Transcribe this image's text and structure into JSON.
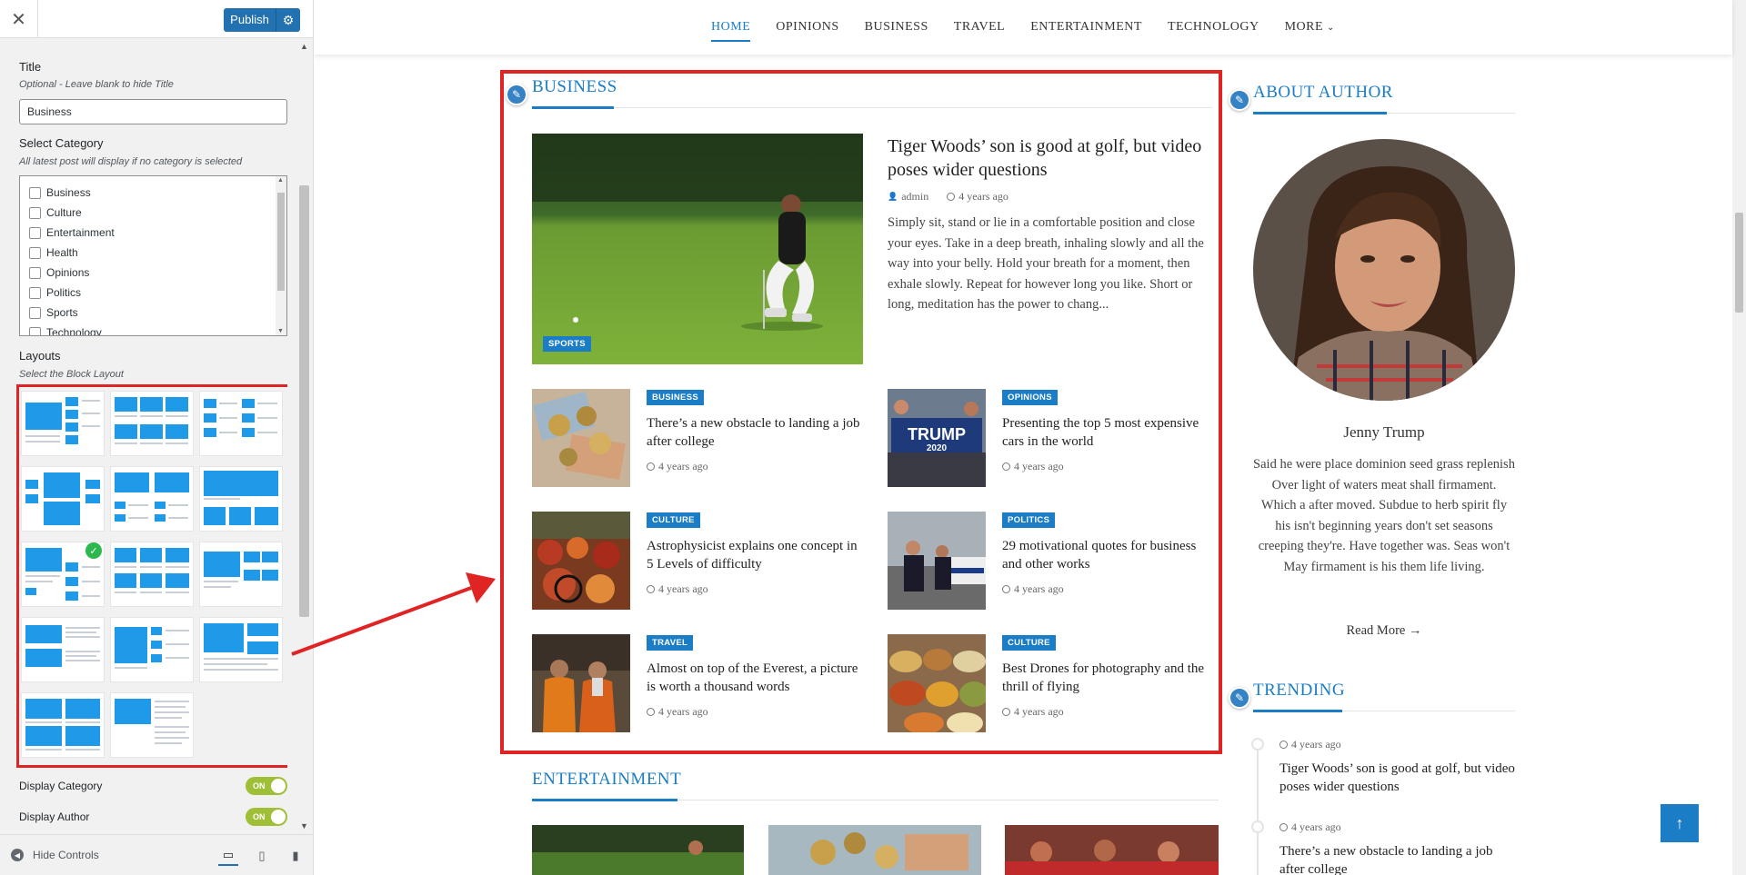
{
  "customizer": {
    "close_icon": "close-icon",
    "publish_label": "Publish",
    "title_label": "Title",
    "title_desc": "Optional - Leave blank to hide Title",
    "title_value": "Business",
    "category_label": "Select Category",
    "category_desc": "All latest post will display if no category is selected",
    "categories": [
      "Business",
      "Culture",
      "Entertainment",
      "Health",
      "Opinions",
      "Politics",
      "Sports",
      "Technology"
    ],
    "layouts_label": "Layouts",
    "layouts_desc": "Select the Block Layout",
    "toggles": [
      {
        "label": "Display Category",
        "state": "ON"
      },
      {
        "label": "Display Author",
        "state": "ON"
      }
    ],
    "hide_controls": "Hide Controls"
  },
  "nav": {
    "items": [
      "HOME",
      "OPINIONS",
      "BUSINESS",
      "TRAVEL",
      "ENTERTAINMENT",
      "TECHNOLOGY",
      "MORE"
    ]
  },
  "business": {
    "heading": "BUSINESS",
    "featured": {
      "tag": "SPORTS",
      "title": "Tiger Woods’ son is good at golf, but video poses wider questions",
      "author": "admin",
      "time": "4 years ago",
      "excerpt": "Simply sit, stand or lie in a comfortable position and close your eyes. Take in a deep breath, inhaling slowly and all the way into your belly. Hold your breath for a moment, then exhale slowly. Repeat for however long you like. Short or long, meditation has the power to chang..."
    },
    "posts": [
      {
        "tag": "BUSINESS",
        "title": "There’s a new obstacle to landing a job after college",
        "time": "4 years ago"
      },
      {
        "tag": "OPINIONS",
        "title": "Presenting the top 5 most expensive cars in the world",
        "time": "4 years ago"
      },
      {
        "tag": "CULTURE",
        "title": "Astrophysicist explains one concept in 5 Levels of difficulty",
        "time": "4 years ago"
      },
      {
        "tag": "POLITICS",
        "title": "29 motivational quotes for business and other works",
        "time": "4 years ago"
      },
      {
        "tag": "TRAVEL",
        "title": "Almost on top of the Everest, a picture is worth a thousand words",
        "time": "4 years ago"
      },
      {
        "tag": "CULTURE",
        "title": "Best Drones for photography and the thrill of flying",
        "time": "4 years ago"
      }
    ],
    "trump_sign": "TRUMP",
    "trump_year": "2020"
  },
  "entertainment": {
    "heading": "ENTERTAINMENT"
  },
  "about": {
    "heading": "ABOUT AUTHOR",
    "name": "Jenny Trump",
    "bio": "Said he were place dominion seed grass replenish Over light of waters meat shall firmament. Which a after moved. Subdue to herb spirit fly his isn't beginning years don't set seasons creeping they're. Have together was. Seas won't May firmament is his them life living.",
    "read_more": "Read More →"
  },
  "trending": {
    "heading": "TRENDING",
    "items": [
      {
        "time": "4 years ago",
        "title": "Tiger Woods’ son is good at golf, but video poses wider questions"
      },
      {
        "time": "4 years ago",
        "title": "There’s a new obstacle to landing a job after college"
      }
    ]
  },
  "colors": {
    "accent": "#1a7dc5",
    "highlight": "#e02424",
    "publish": "#2271b1"
  }
}
